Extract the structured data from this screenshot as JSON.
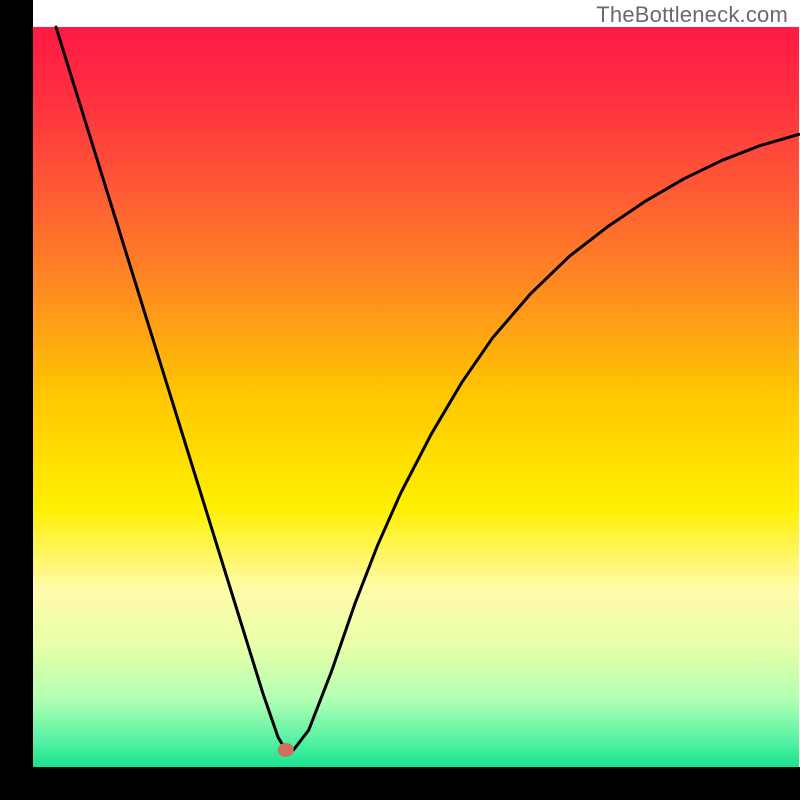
{
  "watermark": "TheBottleneck.com",
  "chart_data": {
    "type": "line",
    "title": "",
    "xlabel": "",
    "ylabel": "",
    "xlim": [
      0,
      100
    ],
    "ylim": [
      0,
      100
    ],
    "series": [
      {
        "name": "curve",
        "x": [
          3,
          6,
          9,
          12,
          15,
          18,
          21,
          24,
          27,
          30,
          32,
          33,
          34,
          36,
          39,
          42,
          45,
          48,
          52,
          56,
          60,
          65,
          70,
          75,
          80,
          85,
          90,
          95,
          100
        ],
        "y": [
          100,
          90,
          80,
          70,
          60,
          50,
          40,
          30,
          20,
          10,
          4,
          2.3,
          2.3,
          5,
          13,
          22,
          30,
          37,
          45,
          52,
          58,
          64,
          69,
          73,
          76.5,
          79.5,
          82,
          84,
          85.5
        ]
      }
    ],
    "marker": {
      "x": 33,
      "y": 2.3,
      "color": "#d06e60"
    },
    "gradient_stops": [
      {
        "pct": 0.0,
        "color": "#ff1944"
      },
      {
        "pct": 0.1,
        "color": "#ff3140"
      },
      {
        "pct": 0.22,
        "color": "#ff5a35"
      },
      {
        "pct": 0.35,
        "color": "#ff8a22"
      },
      {
        "pct": 0.5,
        "color": "#ffc800"
      },
      {
        "pct": 0.65,
        "color": "#fff000"
      },
      {
        "pct": 0.76,
        "color": "#fffbaa"
      },
      {
        "pct": 0.84,
        "color": "#e6ffa8"
      },
      {
        "pct": 0.91,
        "color": "#b0ffb4"
      },
      {
        "pct": 0.97,
        "color": "#4cf0a0"
      },
      {
        "pct": 1.0,
        "color": "#18e28f"
      }
    ],
    "axis_color": "#000000",
    "background": "#ffffff"
  }
}
